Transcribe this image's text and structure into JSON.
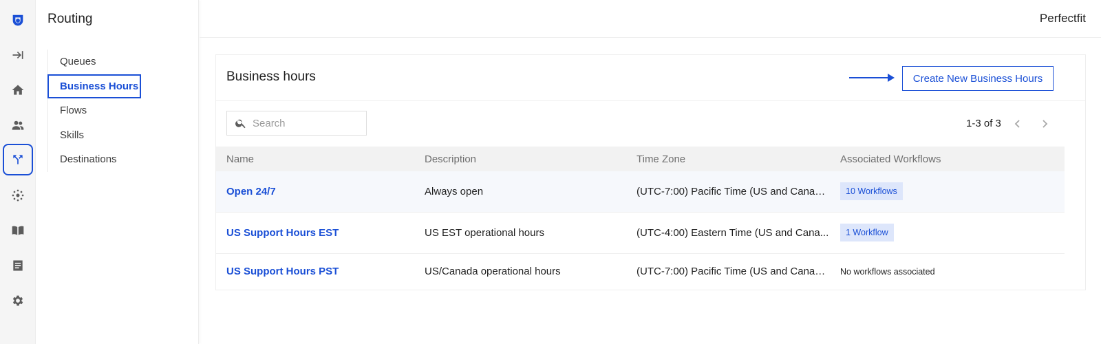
{
  "rail": {
    "icons": [
      "logo-icon",
      "expand-sidebar-icon",
      "home-icon",
      "users-icon",
      "routing-icon",
      "integrations-icon",
      "knowledge-book-icon",
      "reports-icon",
      "settings-icon"
    ],
    "active": "routing-icon",
    "accent": "#1a4fd6"
  },
  "sidebar": {
    "title": "Routing",
    "items": [
      {
        "label": "Queues"
      },
      {
        "label": "Business Hours",
        "active": true
      },
      {
        "label": "Flows"
      },
      {
        "label": "Skills"
      },
      {
        "label": "Destinations"
      }
    ]
  },
  "header": {
    "org_name": "Perfectfit"
  },
  "main": {
    "title": "Business hours",
    "create_button_label": "Create New Business Hours",
    "search": {
      "placeholder": "Search",
      "value": ""
    },
    "pagination": {
      "text": "1-3 of 3"
    },
    "table": {
      "columns": [
        "Name",
        "Description",
        "Time Zone",
        "Associated Workflows"
      ],
      "rows": [
        {
          "name": "Open 24/7",
          "description": "Always open",
          "timezone": "(UTC-7:00) Pacific Time (US and Canad...",
          "workflows": "10 Workflows",
          "workflows_type": "badge"
        },
        {
          "name": "US Support Hours EST",
          "description": "US EST operational hours",
          "timezone": "(UTC-4:00) Eastern Time (US and Cana...",
          "workflows": "1 Workflow",
          "workflows_type": "badge"
        },
        {
          "name": "US Support Hours PST",
          "description": "US/Canada operational hours",
          "timezone": "(UTC-7:00) Pacific Time (US and Canad...",
          "workflows": "No workflows associated",
          "workflows_type": "text"
        }
      ]
    }
  }
}
